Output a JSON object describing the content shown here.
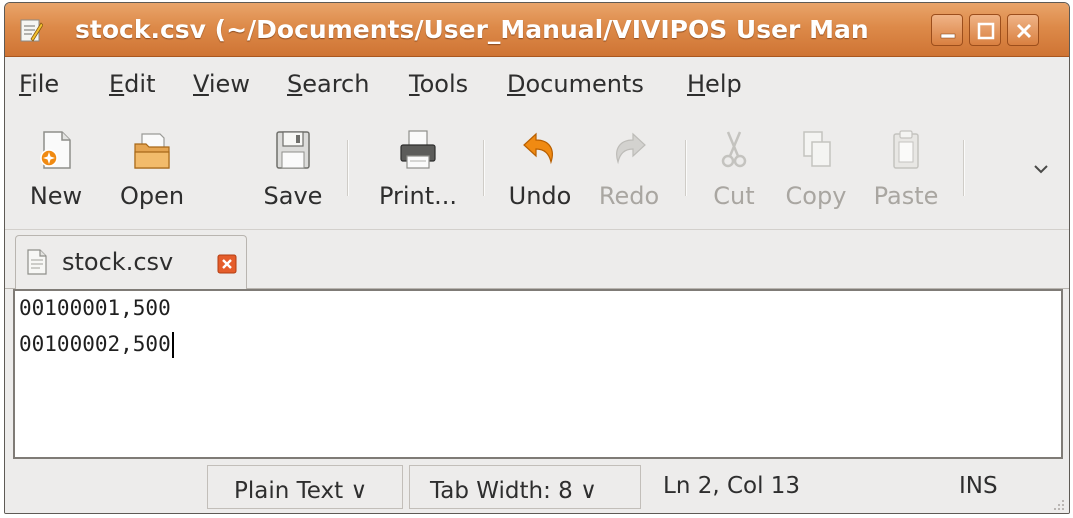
{
  "window": {
    "title": "stock.csv (~/Documents/User_Manual/VIVIPOS User Man",
    "accent_color": "#dd8a49",
    "icon": "text-editor-icon",
    "controls": [
      "minimize-icon",
      "maximize-icon",
      "close-icon"
    ]
  },
  "menu": {
    "file": {
      "acc": "F",
      "rest": "ile"
    },
    "edit": {
      "acc": "E",
      "rest": "dit"
    },
    "view": {
      "acc": "V",
      "rest": "iew"
    },
    "search": {
      "acc": "S",
      "rest": "earch"
    },
    "tools": {
      "acc": "T",
      "rest": "ools"
    },
    "documents": {
      "acc": "D",
      "rest": "ocuments"
    },
    "help": {
      "acc": "H",
      "rest": "elp"
    }
  },
  "toolbar": {
    "new": "New",
    "open": "Open",
    "save": "Save",
    "print": "Print...",
    "undo": "Undo",
    "redo": "Redo",
    "cut": "Cut",
    "copy": "Copy",
    "paste": "Paste",
    "disabled": [
      "Redo",
      "Cut",
      "Copy",
      "Paste"
    ]
  },
  "tab": {
    "label": "stock.csv",
    "icon": "document-icon",
    "close_icon": "close-icon"
  },
  "editor": {
    "lines": [
      "00100001,500",
      "00100002,500"
    ]
  },
  "statusbar": {
    "language": "Plain Text ∨",
    "tab_width": "Tab Width:  8 ∨",
    "position": "Ln 2, Col 13",
    "mode": "INS"
  }
}
